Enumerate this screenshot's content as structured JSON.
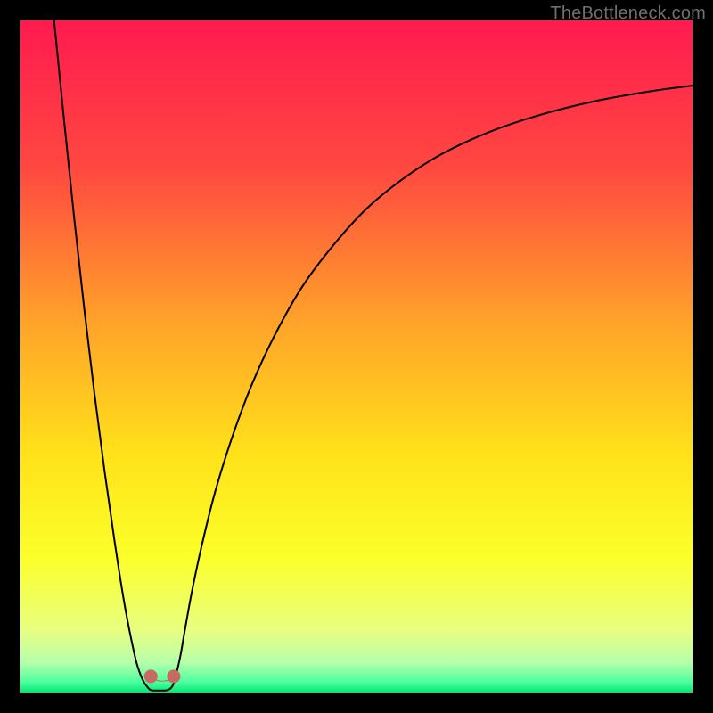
{
  "watermark": {
    "text": "TheBottleneck.com"
  },
  "chart_data": {
    "type": "line",
    "title": "",
    "xlabel": "",
    "ylabel": "",
    "xlim": [
      0,
      100
    ],
    "ylim": [
      0,
      100
    ],
    "grid": false,
    "legend": false,
    "background_gradient": {
      "stops": [
        {
          "offset": 0.0,
          "color": "#ff1a4f"
        },
        {
          "offset": 0.22,
          "color": "#ff4840"
        },
        {
          "offset": 0.45,
          "color": "#ffa329"
        },
        {
          "offset": 0.65,
          "color": "#ffe31a"
        },
        {
          "offset": 0.8,
          "color": "#fbff2a"
        },
        {
          "offset": 0.905,
          "color": "#e9ff7e"
        },
        {
          "offset": 0.955,
          "color": "#b8ffab"
        },
        {
          "offset": 0.985,
          "color": "#4bff9e"
        },
        {
          "offset": 1.0,
          "color": "#00e673"
        }
      ]
    },
    "series": [
      {
        "name": "bottleneck-curve",
        "color": "#000000",
        "stroke_width": 2.0,
        "x": [
          5.0,
          6.5,
          8.0,
          9.5,
          11.0,
          12.5,
          14.0,
          15.5,
          17.0,
          17.8,
          18.4,
          18.9,
          19.3,
          19.7,
          20.0,
          20.5,
          21.0,
          21.5,
          22.0,
          22.5,
          22.9,
          23.2,
          23.8,
          24.5,
          25.5,
          27.0,
          29.0,
          31.5,
          34.5,
          38.0,
          42.0,
          46.5,
          51.5,
          57.0,
          63.0,
          70.0,
          77.5,
          85.5,
          94.0,
          100.0
        ],
        "y": [
          100.0,
          85.0,
          70.5,
          57.0,
          44.5,
          33.0,
          22.5,
          13.0,
          5.5,
          2.8,
          1.5,
          0.8,
          0.4,
          0.3,
          0.3,
          0.3,
          0.3,
          0.3,
          0.4,
          0.8,
          1.6,
          2.8,
          5.5,
          9.5,
          15.0,
          22.0,
          30.0,
          38.0,
          46.0,
          53.5,
          60.5,
          66.5,
          72.0,
          76.5,
          80.3,
          83.5,
          86.0,
          88.0,
          89.5,
          90.3
        ]
      }
    ],
    "markers": [
      {
        "name": "min-marker-left",
        "x": 19.4,
        "y": 2.4,
        "r": 1.0,
        "color": "#c76a64"
      },
      {
        "name": "min-marker-right",
        "x": 22.8,
        "y": 2.4,
        "r": 1.0,
        "color": "#c76a64"
      }
    ],
    "trough_arc": {
      "cx": 21.1,
      "cy": 2.6,
      "rx": 1.7,
      "ry": 1.3,
      "stroke": "#c76a64",
      "stroke_width": 1.1
    }
  }
}
